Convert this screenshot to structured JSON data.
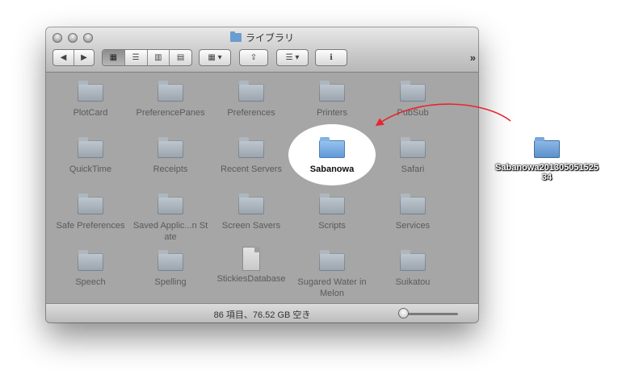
{
  "window": {
    "title": "ライブラリ",
    "status": "86 項目、76.52 GB 空き"
  },
  "toolbar": {
    "back": "◀",
    "forward": "▶",
    "view_icon": "▦",
    "view_list": "☰",
    "view_column": "▥",
    "view_coverflow": "▤",
    "arrange": "▦ ▾",
    "share": "⇪",
    "action": "☰ ▾",
    "info": "ℹ",
    "more": "»"
  },
  "items": [
    {
      "label": "PlotCard",
      "type": "folder"
    },
    {
      "label": "PreferencePanes",
      "type": "folder"
    },
    {
      "label": "Preferences",
      "type": "folder"
    },
    {
      "label": "Printers",
      "type": "folder"
    },
    {
      "label": "PubSub",
      "type": "folder"
    },
    {
      "label": "QuickTime",
      "type": "folder"
    },
    {
      "label": "Receipts",
      "type": "folder"
    },
    {
      "label": "Recent Servers",
      "type": "folder"
    },
    {
      "label": "Sabanowa",
      "type": "folder"
    },
    {
      "label": "Safari",
      "type": "folder"
    },
    {
      "label": "Safe Preferences",
      "type": "folder"
    },
    {
      "label": "Saved Applic...n State",
      "type": "folder"
    },
    {
      "label": "Screen Savers",
      "type": "folder"
    },
    {
      "label": "Scripts",
      "type": "folder"
    },
    {
      "label": "Services",
      "type": "folder"
    },
    {
      "label": "Speech",
      "type": "folder"
    },
    {
      "label": "Spelling",
      "type": "folder"
    },
    {
      "label": "StickiesDatabase",
      "type": "document"
    },
    {
      "label": "Sugared Water in Melon",
      "type": "folder"
    },
    {
      "label": "Suikatou",
      "type": "folder"
    }
  ],
  "desktop": {
    "label": "Sabanowa20130505152534"
  },
  "colors": {
    "arrow": "#e8252b",
    "highlight": "#ffffff"
  }
}
